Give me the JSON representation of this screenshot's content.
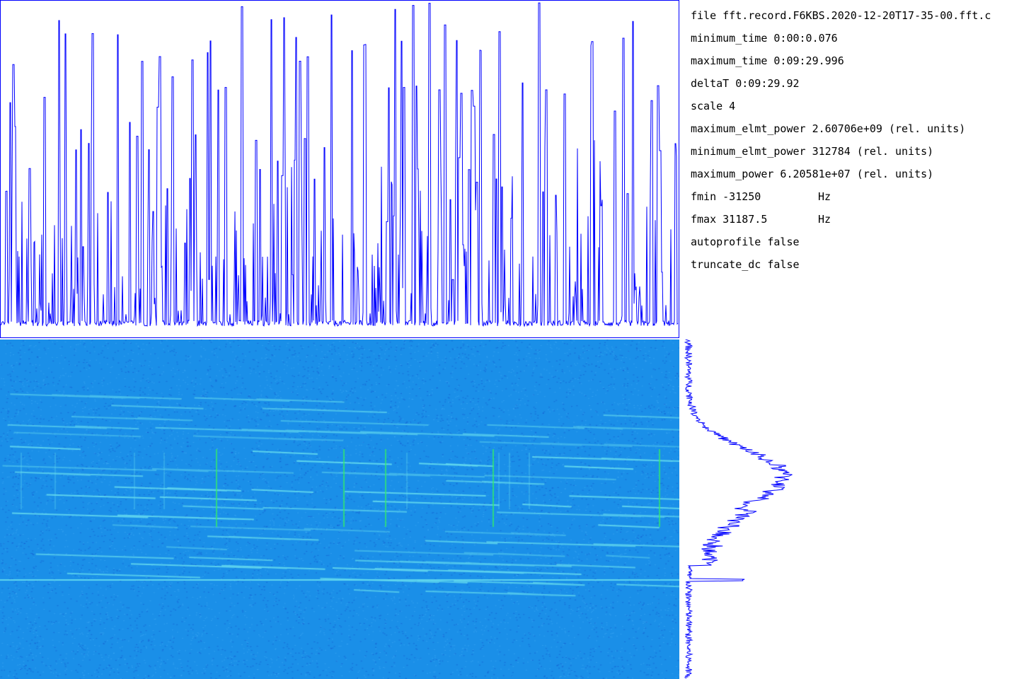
{
  "info": {
    "file": "file fft.record.F6KBS.2020-12-20T17-35-00.fft.c",
    "minimum_time": "minimum_time  0:00:0.076",
    "maximum_time": "maximum_time  0:09:29.996",
    "deltaT": "deltaT  0:09:29.92",
    "scale": "scale 4",
    "maximum_elmt_power": "maximum_elmt_power 2.60706e+09 (rel. units)",
    "minimum_elmt_power": "minimum_elmt_power 312784 (rel. units)",
    "maximum_power": "maximum_power 6.20581e+07 (rel. units)",
    "fmin": "fmin -31250",
    "fmin_unit": "Hz",
    "fmax": "fmax 31187.5",
    "fmax_unit": "Hz",
    "autoprofile": "autoprofile false",
    "truncate_dc": "truncate_dc false"
  },
  "colors": {
    "plot_line": "#0000ff",
    "spectrogram_bg": "#1a8fe8",
    "trace_cyan": "#66ddee",
    "trace_green": "#33ee66"
  }
}
